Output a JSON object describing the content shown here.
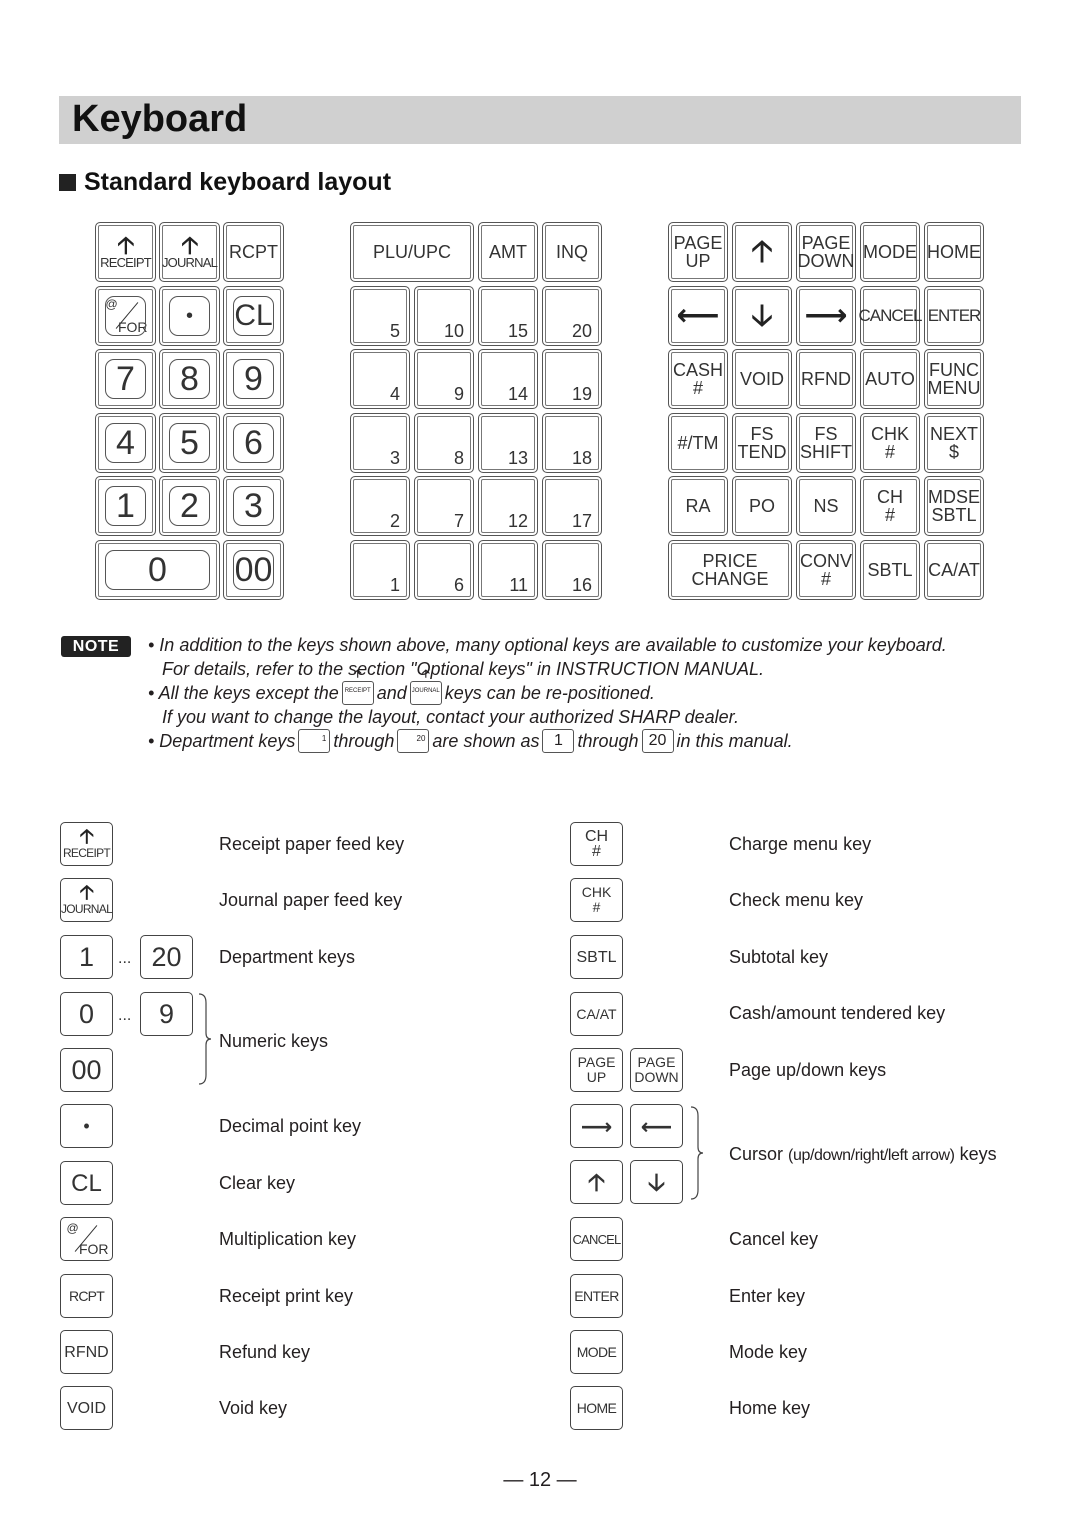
{
  "page": {
    "title": "Keyboard",
    "section_title": "Standard keyboard layout",
    "page_number": "— 12 —"
  },
  "keyboard": {
    "left_block": {
      "row1": [
        {
          "icon": "up-arrow-icon",
          "label": "RECEIPT"
        },
        {
          "icon": "up-arrow-icon",
          "label": "JOURNAL"
        },
        {
          "label": "RCPT"
        }
      ],
      "row2": [
        {
          "top": "@",
          "bottom": "FOR"
        },
        {
          "label": "•"
        },
        {
          "label": "CL"
        }
      ],
      "numpad": [
        "7",
        "8",
        "9",
        "4",
        "5",
        "6",
        "1",
        "2",
        "3"
      ],
      "zero": "0",
      "double_zero": "00"
    },
    "middle_block": {
      "top": [
        "PLU/UPC",
        "AMT",
        "INQ"
      ],
      "dept_rows": [
        [
          "5",
          "10",
          "15",
          "20"
        ],
        [
          "4",
          "9",
          "14",
          "19"
        ],
        [
          "3",
          "8",
          "13",
          "18"
        ],
        [
          "2",
          "7",
          "12",
          "17"
        ],
        [
          "1",
          "6",
          "11",
          "16"
        ]
      ]
    },
    "right_block": {
      "rows": [
        [
          [
            "PAGE",
            "UP"
          ],
          [
            "↑"
          ],
          [
            "PAGE",
            "DOWN"
          ],
          [
            "MODE"
          ],
          [
            "HOME"
          ]
        ],
        [
          [
            "←"
          ],
          [
            "↓"
          ],
          [
            "→"
          ],
          [
            "CANCEL"
          ],
          [
            "ENTER"
          ]
        ],
        [
          [
            "CASH",
            "#"
          ],
          [
            "VOID"
          ],
          [
            "RFND"
          ],
          [
            "AUTO"
          ],
          [
            "FUNC",
            "MENU"
          ]
        ],
        [
          [
            "#/TM"
          ],
          [
            "FS",
            "TEND"
          ],
          [
            "FS",
            "SHIFT"
          ],
          [
            "CHK",
            "#"
          ],
          [
            "NEXT",
            "$"
          ]
        ],
        [
          [
            "RA"
          ],
          [
            "PO"
          ],
          [
            "NS"
          ],
          [
            "CH",
            "#"
          ],
          [
            "MDSE",
            "SBTL"
          ]
        ]
      ],
      "last_row": [
        [
          "PRICE",
          "CHANGE"
        ],
        [
          "CONV",
          "#"
        ],
        [
          "SBTL"
        ],
        [
          "CA/AT"
        ]
      ]
    }
  },
  "note": {
    "badge": "NOTE",
    "line1": "• In addition to the keys shown above, many optional keys are available to customize your keyboard.",
    "line2": "For details, refer to the section \"Optional keys\" in INSTRUCTION MANUAL.",
    "line3_a": "• All the keys except the",
    "line3_b": "and",
    "line3_c": "keys can be re-positioned.",
    "line4": "If you want to change the layout, contact your authorized SHARP dealer.",
    "line5_a": "• Department keys",
    "line5_b": "through",
    "line5_c": "are shown as",
    "line5_d": "through",
    "line5_e": "in this manual.",
    "key_receipt": "RECEIPT",
    "key_journal": "JOURNAL",
    "dept_small_1": "1",
    "dept_small_20": "20",
    "dept_shown_1": "1",
    "dept_shown_20": "20"
  },
  "legend": {
    "left": [
      {
        "keys": [
          "RECEIPT"
        ],
        "text": "Receipt paper feed key"
      },
      {
        "keys": [
          "JOURNAL"
        ],
        "text": "Journal paper feed key"
      },
      {
        "keys": [
          "1",
          "20"
        ],
        "text": "Department keys"
      },
      {
        "keys": [
          "0",
          "9",
          "00"
        ],
        "text": "Numeric keys"
      },
      {
        "keys": [
          "•"
        ],
        "text": "Decimal point key"
      },
      {
        "keys": [
          "CL"
        ],
        "text": "Clear key"
      },
      {
        "keys": [
          "@/FOR"
        ],
        "text": "Multiplication key"
      },
      {
        "keys": [
          "RCPT"
        ],
        "text": "Receipt print key"
      },
      {
        "keys": [
          "RFND"
        ],
        "text": "Refund key"
      },
      {
        "keys": [
          "VOID"
        ],
        "text": "Void key"
      }
    ],
    "right": [
      {
        "keys": [
          "CH #"
        ],
        "text": "Charge menu key"
      },
      {
        "keys": [
          "CHK #"
        ],
        "text": "Check menu key"
      },
      {
        "keys": [
          "SBTL"
        ],
        "text": "Subtotal key"
      },
      {
        "keys": [
          "CA/AT"
        ],
        "text": "Cash/amount tendered key"
      },
      {
        "keys": [
          "PAGE UP",
          "PAGE DOWN"
        ],
        "text": "Page up/down keys"
      },
      {
        "keys": [
          "→",
          "←",
          "↑",
          "↓"
        ],
        "text_a": "Cursor",
        "text_b": "(up/down/right/left arrow)",
        "text_c": "keys"
      },
      {
        "keys": [
          "CANCEL"
        ],
        "text": "Cancel key"
      },
      {
        "keys": [
          "ENTER"
        ],
        "text": "Enter key"
      },
      {
        "keys": [
          "MODE"
        ],
        "text": "Mode key"
      },
      {
        "keys": [
          "HOME"
        ],
        "text": "Home key"
      }
    ],
    "ellipsis": "..."
  }
}
